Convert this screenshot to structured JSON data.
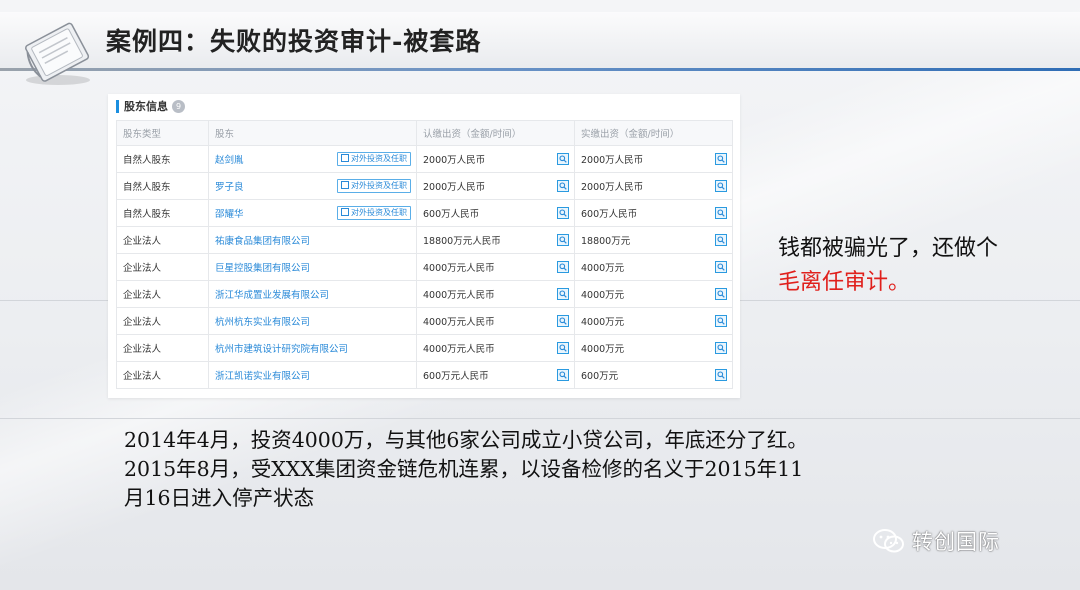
{
  "slide": {
    "title": "案例四：失败的投资审计-被套路",
    "note_line1": "钱都被骗光了，还做个",
    "note_line2": "毛离任审计。",
    "paragraph_line1": "2014年4月，投资4000万，与其他6家公司成立小贷公司，年底还分了红。",
    "paragraph_line2": "2015年8月，受XXX集团资金链危机连累，以设备检修的名义于2015年11",
    "paragraph_line3": "月16日进入停产状态",
    "watermark": "转创国际",
    "accent_color": "#e0201c",
    "link_color": "#2a8ad8"
  },
  "shareholders": {
    "section_title": "股东信息",
    "count": "9",
    "columns": [
      "股东类型",
      "股东",
      "认缴出资（金额/时间）",
      "实缴出资（金额/时间）"
    ],
    "tag_label": "对外投资及任职",
    "rows": [
      {
        "type": "自然人股东",
        "name": "赵剑胤",
        "subscribed": "2000万人民币",
        "paid": "2000万人民币",
        "has_tag": true
      },
      {
        "type": "自然人股东",
        "name": "罗子良",
        "subscribed": "2000万人民币",
        "paid": "2000万人民币",
        "has_tag": true
      },
      {
        "type": "自然人股东",
        "name": "邵耀华",
        "subscribed": "600万人民币",
        "paid": "600万人民币",
        "has_tag": true
      },
      {
        "type": "企业法人",
        "name": "祐康食品集团有限公司",
        "subscribed": "18800万元人民币",
        "paid": "18800万元",
        "has_tag": false
      },
      {
        "type": "企业法人",
        "name": "巨星控股集团有限公司",
        "subscribed": "4000万元人民币",
        "paid": "4000万元",
        "has_tag": false
      },
      {
        "type": "企业法人",
        "name": "浙江华成置业发展有限公司",
        "subscribed": "4000万元人民币",
        "paid": "4000万元",
        "has_tag": false
      },
      {
        "type": "企业法人",
        "name": "杭州杭东实业有限公司",
        "subscribed": "4000万元人民币",
        "paid": "4000万元",
        "has_tag": false
      },
      {
        "type": "企业法人",
        "name": "杭州市建筑设计研究院有限公司",
        "subscribed": "4000万元人民币",
        "paid": "4000万元",
        "has_tag": false
      },
      {
        "type": "企业法人",
        "name": "浙江凯诺实业有限公司",
        "subscribed": "600万元人民币",
        "paid": "600万元",
        "has_tag": false
      }
    ]
  }
}
